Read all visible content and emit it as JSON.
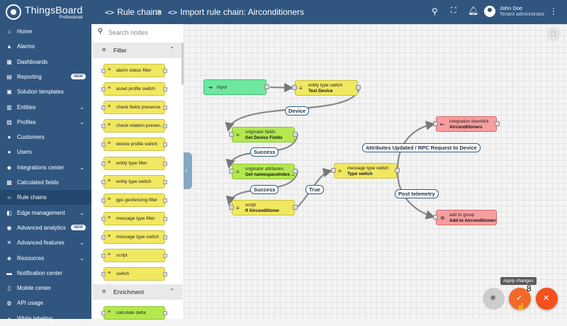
{
  "app": {
    "brand": "ThingsBoard",
    "brand_sub": "Professional"
  },
  "header": {
    "breadcrumb_1": "Rule chains",
    "separator": ">",
    "breadcrumb_2": "Import rule chain: Airconditioners",
    "user_name": "John Doe",
    "user_role": "Tenant administrator"
  },
  "sidebar": {
    "items": [
      {
        "label": "Home",
        "icon": "home-icon",
        "glyph": "⌂"
      },
      {
        "label": "Alarms",
        "icon": "alarm-icon",
        "glyph": "▲"
      },
      {
        "label": "Dashboards",
        "icon": "dashboard-icon",
        "glyph": "▦"
      },
      {
        "label": "Reporting",
        "icon": "reporting-icon",
        "glyph": "▤",
        "badge": "NEW"
      },
      {
        "label": "Solution templates",
        "icon": "templates-icon",
        "glyph": "▣"
      },
      {
        "label": "Entities",
        "icon": "entities-icon",
        "glyph": "▥",
        "chevron": true
      },
      {
        "label": "Profiles",
        "icon": "profiles-icon",
        "glyph": "▧",
        "chevron": true
      },
      {
        "label": "Customers",
        "icon": "customers-icon",
        "glyph": "●"
      },
      {
        "label": "Users",
        "icon": "users-icon",
        "glyph": "●"
      },
      {
        "label": "Integrations center",
        "icon": "integrations-icon",
        "glyph": "◆",
        "chevron": true
      },
      {
        "label": "Calculated fields",
        "icon": "calculated-fields-icon",
        "glyph": "▩"
      },
      {
        "label": "Rule chains",
        "icon": "rule-chains-icon",
        "glyph": "‹›",
        "active": true
      },
      {
        "label": "Edge management",
        "icon": "edge-icon",
        "glyph": "◧",
        "chevron": true
      },
      {
        "label": "Advanced analytics",
        "icon": "analytics-icon",
        "glyph": "◉",
        "badge": "NEW"
      },
      {
        "label": "Advanced features",
        "icon": "features-icon",
        "glyph": "✕",
        "chevron": true
      },
      {
        "label": "Resources",
        "icon": "resources-icon",
        "glyph": "◈",
        "chevron": true
      },
      {
        "label": "Notification center",
        "icon": "notification-icon",
        "glyph": "▬"
      },
      {
        "label": "Mobile center",
        "icon": "mobile-icon",
        "glyph": "▯"
      },
      {
        "label": "API usage",
        "icon": "api-usage-icon",
        "glyph": "◍"
      },
      {
        "label": "White labeling",
        "icon": "white-labeling-icon",
        "glyph": "▪"
      }
    ]
  },
  "palette": {
    "search_placeholder": "Search nodes",
    "filter_section": "Filter",
    "filter_nodes": [
      "alarm status filter",
      "asset profile switch",
      "check fields presence",
      "check relation presen...",
      "device profile switch",
      "entity type filter",
      "entity type switch",
      "gps geofencing filter",
      "message type filter",
      "message type switch",
      "script",
      "switch"
    ],
    "enrichment_section": "Enrichment",
    "enrichment_nodes": [
      "calculate delta"
    ]
  },
  "rule_nodes": {
    "input": {
      "name": "Input"
    },
    "entity_switch": {
      "type": "entity type switch",
      "name": "Test Device"
    },
    "orig_fields": {
      "type": "originator fields",
      "name": "Get Device Fields"
    },
    "orig_attrs": {
      "type": "originator attributes",
      "name": "Get namespaceIndex ..."
    },
    "script": {
      "type": "script",
      "name": "If Airconditioner"
    },
    "msg_switch": {
      "type": "message type switch",
      "name": "Type switch"
    },
    "integration": {
      "type": "integration downlink",
      "name": "Airconditioners"
    },
    "add_group": {
      "type": "add to group",
      "name": "Add to Airconditioners"
    }
  },
  "edge_labels": {
    "device": "Device",
    "success_1": "Success",
    "success_2": "Success",
    "true": "True",
    "attributes": "Attributes Updated / RPC Request to Device",
    "post_telemetry": "Post telemetry"
  },
  "actions": {
    "tooltip": "Apply changes",
    "pending_count": "8"
  },
  "colors": {
    "header": "#305680",
    "filter_node": "#f1e861",
    "enrichment_node": "#b3e94e",
    "input_node": "#6ee79f",
    "external_node": "#f79e9e",
    "apply_button": "#f26a2a",
    "cancel_button": "#f4511e"
  }
}
